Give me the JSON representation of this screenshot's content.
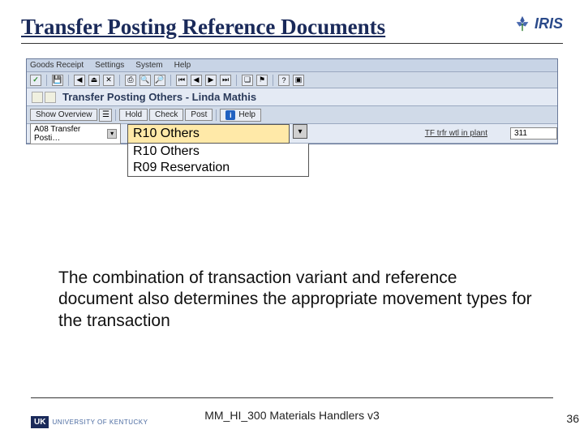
{
  "title": "Transfer Posting Reference Documents",
  "logo": {
    "brand": "IRIS"
  },
  "sap": {
    "menubar": [
      "Goods Receipt",
      "Settings",
      "System",
      "Help"
    ],
    "window_title": "Transfer Posting Others - Linda Mathis",
    "toolbar2": {
      "show_overview": "Show Overview",
      "hold": "Hold",
      "check": "Check",
      "post": "Post",
      "help": "Help"
    },
    "field_combo1": "A08 Transfer Posti…",
    "movement_label": "TF trfr wtl in plant",
    "movement_code": "311",
    "dropdown": {
      "selected": "R10 Others",
      "options": [
        "R10 Others",
        "R09 Reservation"
      ]
    }
  },
  "body_text": "The combination of transaction variant and reference document also determines the appropriate movement types for the transaction",
  "footer": {
    "label": "MM_HI_300 Materials Handlers v3",
    "page": "36",
    "uk_abbr": "UK",
    "uk_name": "UNIVERSITY OF KENTUCKY"
  }
}
